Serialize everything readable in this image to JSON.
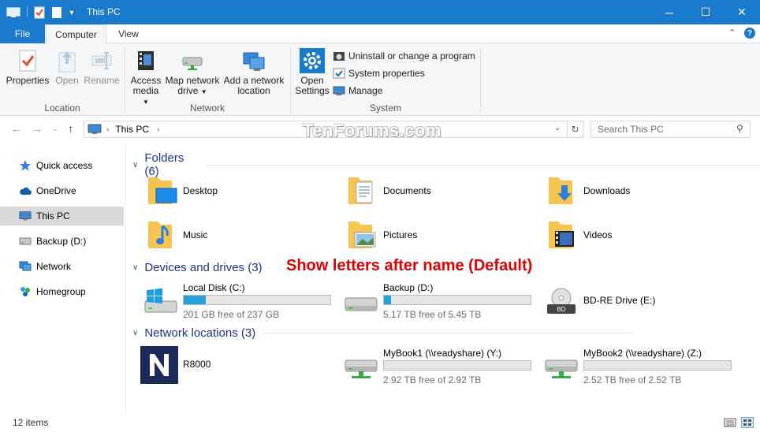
{
  "window": {
    "title": "This PC"
  },
  "tabs": {
    "file": "File",
    "computer": "Computer",
    "view": "View"
  },
  "ribbon": {
    "location": {
      "label": "Location",
      "properties": "Properties",
      "open": "Open",
      "rename": "Rename"
    },
    "network": {
      "label": "Network",
      "access_media_1": "Access",
      "access_media_2": "media",
      "map_drive_1": "Map network",
      "map_drive_2": "drive",
      "add_location_1": "Add a network",
      "add_location_2": "location"
    },
    "system": {
      "label": "System",
      "open_settings_1": "Open",
      "open_settings_2": "Settings",
      "uninstall": "Uninstall or change a program",
      "system_properties": "System properties",
      "manage": "Manage"
    }
  },
  "address": {
    "crumb": "This PC"
  },
  "search": {
    "placeholder": "Search This PC"
  },
  "watermark": "TenForums.com",
  "nav": [
    {
      "label": "Quick access",
      "icon": "star-icon"
    },
    {
      "label": "OneDrive",
      "icon": "cloud-icon"
    },
    {
      "label": "This PC",
      "icon": "computer-icon",
      "selected": true
    },
    {
      "label": "Backup (D:)",
      "icon": "drive-icon"
    },
    {
      "label": "Network",
      "icon": "network-icon"
    },
    {
      "label": "Homegroup",
      "icon": "homegroup-icon"
    }
  ],
  "groups": {
    "folders": "Folders (6)",
    "devices": "Devices and drives (3)",
    "network": "Network locations (3)"
  },
  "folders": [
    "Desktop",
    "Documents",
    "Downloads",
    "Music",
    "Pictures",
    "Videos"
  ],
  "drives": [
    {
      "name": "Local Disk (C:)",
      "free": "201 GB free of 237 GB",
      "used_fraction": 0.15
    },
    {
      "name": "Backup (D:)",
      "free": "5.17 TB free of 5.45 TB",
      "used_fraction": 0.05
    },
    {
      "name": "BD-RE Drive (E:)"
    }
  ],
  "network_locations": [
    {
      "name": "R8000"
    },
    {
      "name": "MyBook1 (\\\\readyshare) (Y:)",
      "free": "2.92 TB free of 2.92 TB",
      "used_fraction": 0.0
    },
    {
      "name": "MyBook2 (\\\\readyshare) (Z:)",
      "free": "2.52 TB free of 2.52 TB",
      "used_fraction": 0.0
    }
  ],
  "annotation": "Show letters after name (Default)",
  "status": {
    "items": "12 items"
  },
  "colors": {
    "accent": "#1979ca",
    "group_header": "#1e3287",
    "bar_fill": "#26a0da",
    "annotation": "#e00000"
  }
}
